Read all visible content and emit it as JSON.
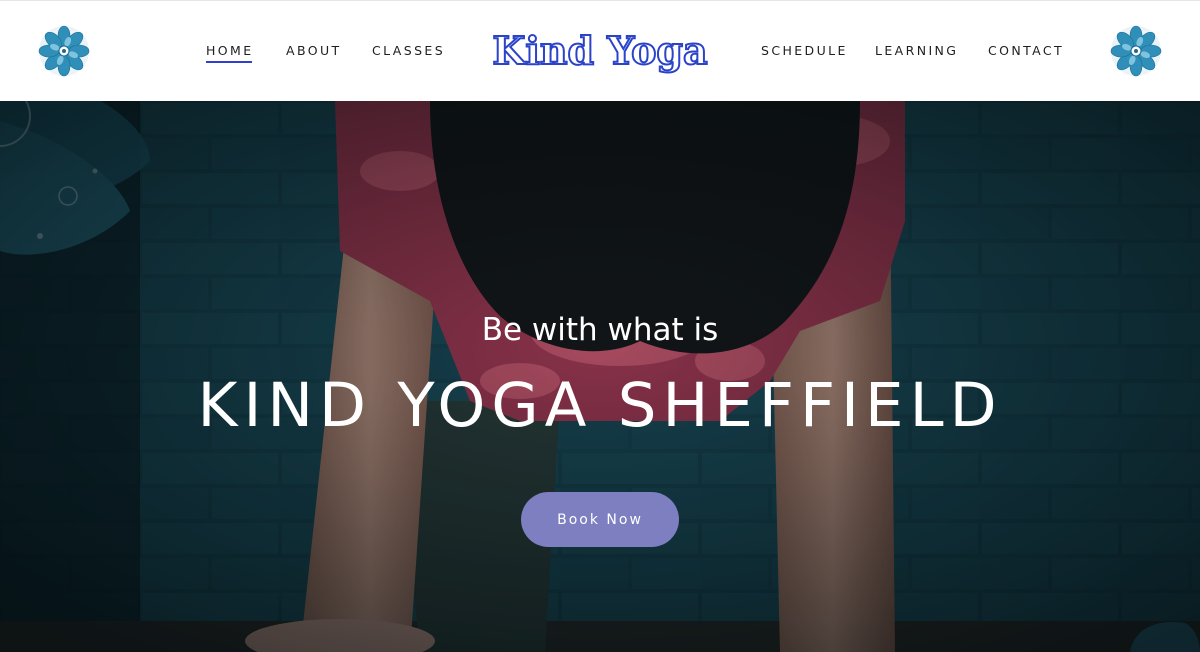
{
  "header": {
    "logo_text": "Kind Yoga",
    "nav_left": [
      {
        "label": "HOME",
        "active": true
      },
      {
        "label": "ABOUT",
        "active": false
      },
      {
        "label": "CLASSES",
        "active": false
      }
    ],
    "nav_right": [
      {
        "label": "SCHEDULE",
        "active": false
      },
      {
        "label": "LEARNING",
        "active": false
      },
      {
        "label": "CONTACT",
        "active": false
      }
    ],
    "icons": {
      "left": "mandala-flower-icon",
      "right": "mandala-flower-icon"
    }
  },
  "hero": {
    "subtitle": "Be with what is",
    "title": "KIND YOGA SHEFFIELD",
    "cta_label": "Book Now"
  },
  "colors": {
    "nav_active_underline": "#2f3fd0",
    "logo_blue": "#2a43c9",
    "cta_background": "#7d7fc0",
    "hero_wall": "#153b46",
    "mandala_teal": "#2f8fb8"
  }
}
